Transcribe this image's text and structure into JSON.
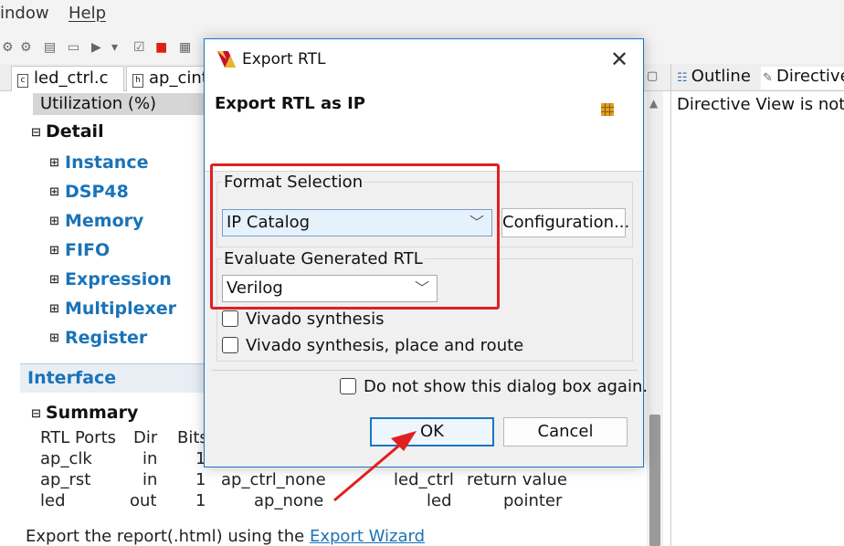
{
  "menubar": {
    "items": [
      "indow",
      "Help"
    ]
  },
  "tabs": [
    {
      "label": "led_ctrl.c",
      "icon": "c-file-icon"
    },
    {
      "label": "ap_cint",
      "icon": "h-file-icon"
    }
  ],
  "right_panel": {
    "tabs": [
      "Outline",
      "Directive"
    ],
    "message": "Directive View is not a"
  },
  "report": {
    "utilization_label": "Utilization (%)",
    "detail_title": "Detail",
    "detail_items": [
      "Instance",
      "DSP48",
      "Memory",
      "FIFO",
      "Expression",
      "Multiplexer",
      "Register"
    ],
    "interface_title": "Interface",
    "summary_title": "Summary",
    "columns": [
      "RTL Ports",
      "Dir",
      "Bits"
    ],
    "rows": [
      {
        "port": "ap_clk",
        "dir": "in",
        "bits": "1",
        "protocol": "",
        "object": "",
        "type": ""
      },
      {
        "port": "ap_rst",
        "dir": "in",
        "bits": "1",
        "protocol": "ap_ctrl_none",
        "object": "led_ctrl",
        "type": "return value"
      },
      {
        "port": "led",
        "dir": "out",
        "bits": "1",
        "protocol": "ap_none",
        "object": "led",
        "type": "pointer"
      }
    ],
    "footer_text": "Export the report(.html) using the ",
    "footer_link": "Export Wizard"
  },
  "dialog": {
    "title": "Export RTL",
    "heading": "Export RTL as IP",
    "format_group_label": "Format Selection",
    "format_value": "IP Catalog",
    "configuration_button": "Configuration...",
    "evaluate_group_label": "Evaluate Generated RTL",
    "language_value": "Verilog",
    "vivado_synthesis_label": "Vivado synthesis",
    "vivado_pnr_label": "Vivado synthesis, place and route",
    "dont_show_label": "Do not show this dialog box again.",
    "ok_button": "OK",
    "cancel_button": "Cancel"
  },
  "colors": {
    "link_blue": "#1a73b8",
    "highlight_red": "#e02020",
    "dialog_border": "#1b75c4"
  }
}
